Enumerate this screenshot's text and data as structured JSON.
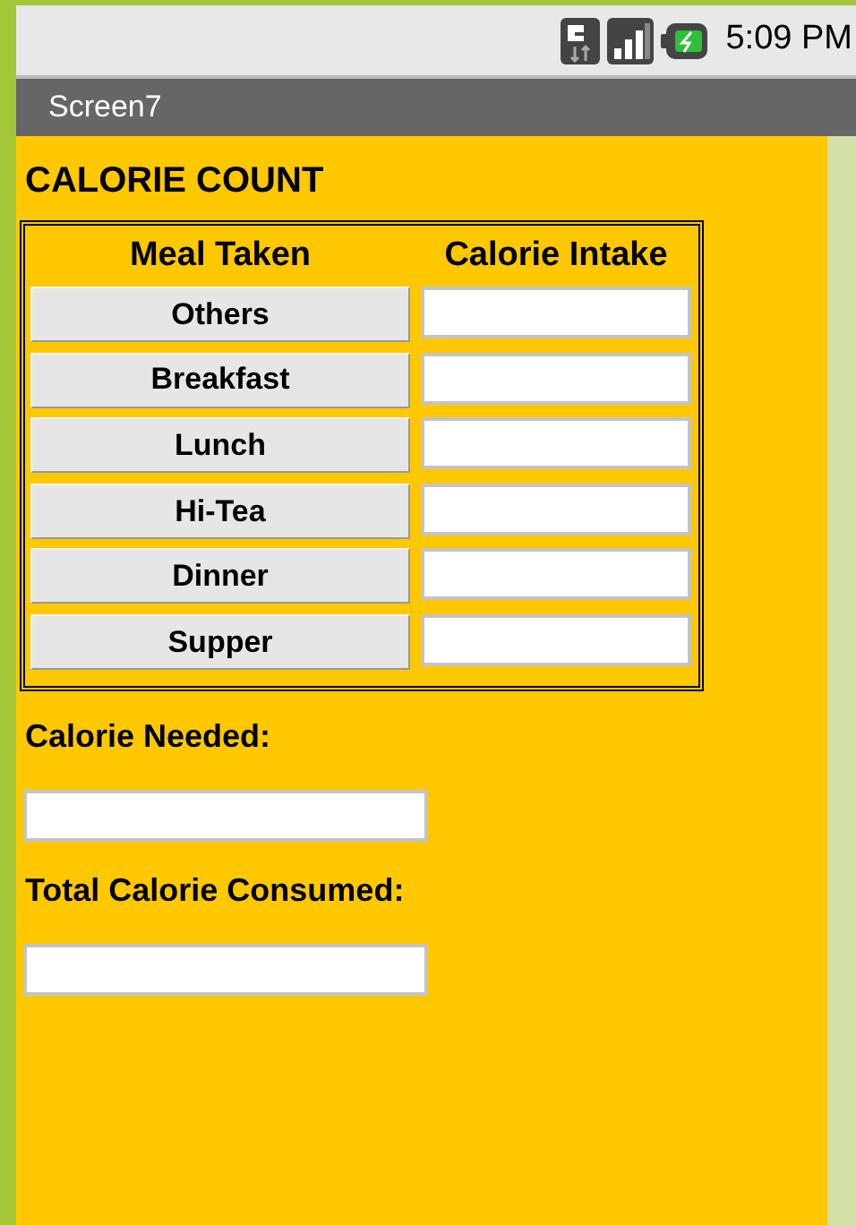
{
  "status_bar": {
    "time": "5:09 PM"
  },
  "title_bar": {
    "title": "Screen7"
  },
  "heading": "CALORIE COUNT",
  "table": {
    "columns": [
      "Meal Taken",
      "Calorie Intake"
    ],
    "rows": [
      {
        "meal": "Others"
      },
      {
        "meal": "Breakfast"
      },
      {
        "meal": "Lunch"
      },
      {
        "meal": "Hi-Tea"
      },
      {
        "meal": "Dinner"
      },
      {
        "meal": "Supper"
      }
    ]
  },
  "fields": [
    {
      "label": "Calorie Needed:"
    },
    {
      "label": "Total Calorie Consumed:"
    }
  ]
}
